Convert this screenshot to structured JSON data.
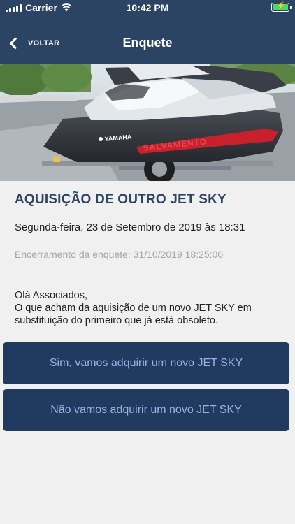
{
  "status_bar": {
    "carrier": "Carrier",
    "time": "10:42 PM",
    "battery_level": 1.0
  },
  "nav": {
    "back_label": "VOLTAR",
    "title": "Enquete"
  },
  "hero": {
    "brand_text": "YAMAHA",
    "hull_text": "SALVAMENTO"
  },
  "poll": {
    "title": "AQUISIÇÃO DE OUTRO JET SKY",
    "date": "Segunda-feira, 23 de Setembro de 2019 às 18:31",
    "closing": "Encerramento da enquete: 31/10/2019 18:25:00",
    "greeting": "Olá Associados,",
    "body": "O que acham da aquisição de um novo JET SKY em substituição do primeiro que já está obsoleto."
  },
  "options": [
    {
      "label": "Sim, vamos adquirir um novo JET SKY"
    },
    {
      "label": "Não vamos adquirir um novo JET SKY"
    }
  ],
  "colors": {
    "header": "#2c4464",
    "button": "#213a5f",
    "button_text": "#9db0e6",
    "background": "#f0f0f1"
  }
}
